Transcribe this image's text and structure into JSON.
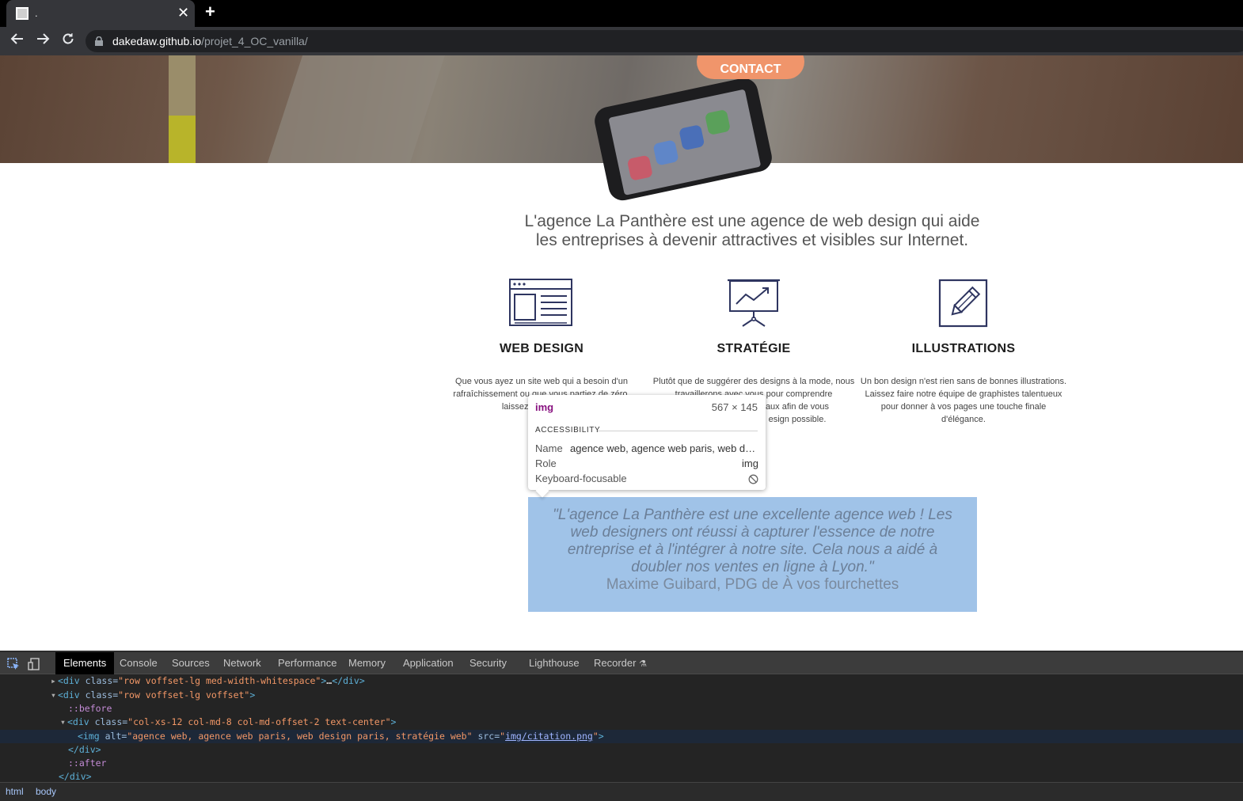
{
  "browser": {
    "tab_title": ".",
    "new_tab_glyph": "+",
    "close_glyph": "✕",
    "url_host": "dakedaw.github.io",
    "url_path": "/projet_4_OC_vanilla/"
  },
  "hero": {
    "contact_label": "CONTACT"
  },
  "intro": {
    "line1": "L'agence La Panthère est une agence de web design qui aide",
    "line2": "les entreprises à devenir attractives et visibles sur Internet."
  },
  "services": [
    {
      "title": "WEB DESIGN",
      "icon": "browser-window-icon",
      "text": "Que vous ayez un site web qui a besoin d'un rafraîchissement ou que vous partiez de zéro, laissez-nous vous re"
    },
    {
      "title": "STRATÉGIE",
      "icon": "presentation-chart-icon",
      "text": "Plutôt que de suggérer des designs à la mode, nous travaillerons avec vous pour comprendre"
    },
    {
      "title": "ILLUSTRATIONS",
      "icon": "pencil-icon",
      "text": "Un bon design n'est rien sans de bonnes illustrations. Laissez faire notre équipe de graphistes talentueux pour donner à vos pages une touche finale d'élégance."
    }
  ],
  "services_fragments": {
    "web_design_tail": "se",
    "strategy_tail_1": "aux afin de vous",
    "strategy_tail_2": "esign possible."
  },
  "quote": {
    "text": "\"L'agence La Panthère est une excellente agence web ! Les web designers ont réussi à capturer l'essence de notre entreprise et à l'intégrer à notre site. Cela nous a aidé à doubler nos ventes en ligne à Lyon.\"",
    "author": "Maxime Guibard, PDG de À vos fourchettes"
  },
  "inspector_tooltip": {
    "tag": "img",
    "size": "567 × 145",
    "section": "ACCESSIBILITY",
    "name_label": "Name",
    "name_value": "agence web, agence web paris, web de...",
    "role_label": "Role",
    "role_value": "img",
    "focus_label": "Keyboard-focusable"
  },
  "devtools": {
    "tabs": [
      "Elements",
      "Console",
      "Sources",
      "Network",
      "Performance",
      "Memory",
      "Application",
      "Security",
      "Lighthouse",
      "Recorder"
    ],
    "active_tab": "Elements",
    "dom_lines": {
      "l1_open": "<div",
      "l1_class_attr": " class=",
      "l1_class_val": "\"row voffset-lg med-width-whitespace\"",
      "l1_close": ">",
      "l1_ellipsis": "…",
      "l1_end": "</div>",
      "l2_open": "<div",
      "l2_class_attr": " class=",
      "l2_class_val": "\"row voffset-lg voffset\"",
      "l2_close": ">",
      "l3_pseudo": "::before",
      "l4_open": "<div",
      "l4_class_attr": " class=",
      "l4_class_val": "\"col-xs-12 col-md-8 col-md-offset-2 text-center\"",
      "l4_close": ">",
      "l5_open": "<img",
      "l5_alt_attr": " alt=",
      "l5_alt_val": "\"agence web, agence web paris, web design paris, stratégie web\"",
      "l5_src_attr": " src=",
      "l5_src_q1": "\"",
      "l5_src_val": "img/citation.png",
      "l5_src_q2": "\"",
      "l5_close": ">",
      "l6": "</div>",
      "l7_pseudo": "::after",
      "l8": "</div>"
    },
    "breadcrumbs": [
      "html",
      "body"
    ]
  },
  "colors": {
    "contact_button": "#f0956b",
    "quote_background": "#a0c3e8",
    "icon_stroke": "#2e3560"
  }
}
